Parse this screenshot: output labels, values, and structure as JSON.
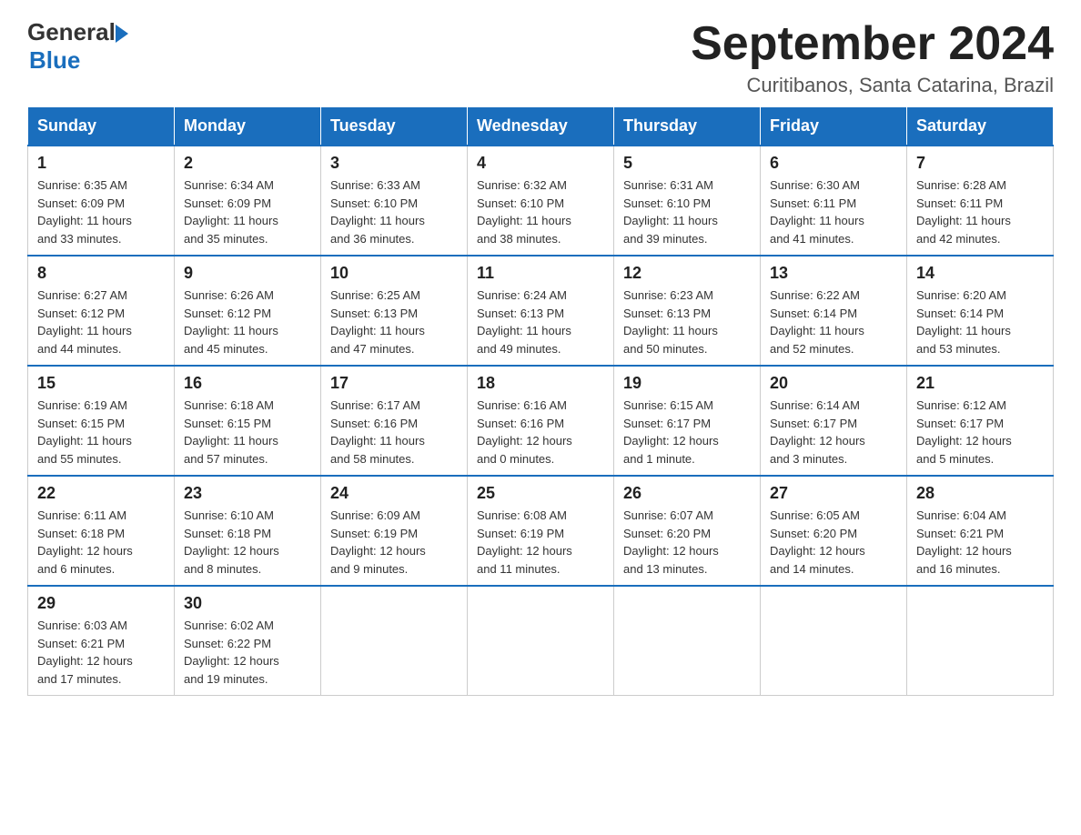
{
  "logo": {
    "text_general": "General",
    "text_blue": "Blue"
  },
  "title": "September 2024",
  "subtitle": "Curitibanos, Santa Catarina, Brazil",
  "days_of_week": [
    "Sunday",
    "Monday",
    "Tuesday",
    "Wednesday",
    "Thursday",
    "Friday",
    "Saturday"
  ],
  "weeks": [
    [
      {
        "day": "1",
        "sunrise": "6:35 AM",
        "sunset": "6:09 PM",
        "daylight": "11 hours and 33 minutes."
      },
      {
        "day": "2",
        "sunrise": "6:34 AM",
        "sunset": "6:09 PM",
        "daylight": "11 hours and 35 minutes."
      },
      {
        "day": "3",
        "sunrise": "6:33 AM",
        "sunset": "6:10 PM",
        "daylight": "11 hours and 36 minutes."
      },
      {
        "day": "4",
        "sunrise": "6:32 AM",
        "sunset": "6:10 PM",
        "daylight": "11 hours and 38 minutes."
      },
      {
        "day": "5",
        "sunrise": "6:31 AM",
        "sunset": "6:10 PM",
        "daylight": "11 hours and 39 minutes."
      },
      {
        "day": "6",
        "sunrise": "6:30 AM",
        "sunset": "6:11 PM",
        "daylight": "11 hours and 41 minutes."
      },
      {
        "day": "7",
        "sunrise": "6:28 AM",
        "sunset": "6:11 PM",
        "daylight": "11 hours and 42 minutes."
      }
    ],
    [
      {
        "day": "8",
        "sunrise": "6:27 AM",
        "sunset": "6:12 PM",
        "daylight": "11 hours and 44 minutes."
      },
      {
        "day": "9",
        "sunrise": "6:26 AM",
        "sunset": "6:12 PM",
        "daylight": "11 hours and 45 minutes."
      },
      {
        "day": "10",
        "sunrise": "6:25 AM",
        "sunset": "6:13 PM",
        "daylight": "11 hours and 47 minutes."
      },
      {
        "day": "11",
        "sunrise": "6:24 AM",
        "sunset": "6:13 PM",
        "daylight": "11 hours and 49 minutes."
      },
      {
        "day": "12",
        "sunrise": "6:23 AM",
        "sunset": "6:13 PM",
        "daylight": "11 hours and 50 minutes."
      },
      {
        "day": "13",
        "sunrise": "6:22 AM",
        "sunset": "6:14 PM",
        "daylight": "11 hours and 52 minutes."
      },
      {
        "day": "14",
        "sunrise": "6:20 AM",
        "sunset": "6:14 PM",
        "daylight": "11 hours and 53 minutes."
      }
    ],
    [
      {
        "day": "15",
        "sunrise": "6:19 AM",
        "sunset": "6:15 PM",
        "daylight": "11 hours and 55 minutes."
      },
      {
        "day": "16",
        "sunrise": "6:18 AM",
        "sunset": "6:15 PM",
        "daylight": "11 hours and 57 minutes."
      },
      {
        "day": "17",
        "sunrise": "6:17 AM",
        "sunset": "6:16 PM",
        "daylight": "11 hours and 58 minutes."
      },
      {
        "day": "18",
        "sunrise": "6:16 AM",
        "sunset": "6:16 PM",
        "daylight": "12 hours and 0 minutes."
      },
      {
        "day": "19",
        "sunrise": "6:15 AM",
        "sunset": "6:17 PM",
        "daylight": "12 hours and 1 minute."
      },
      {
        "day": "20",
        "sunrise": "6:14 AM",
        "sunset": "6:17 PM",
        "daylight": "12 hours and 3 minutes."
      },
      {
        "day": "21",
        "sunrise": "6:12 AM",
        "sunset": "6:17 PM",
        "daylight": "12 hours and 5 minutes."
      }
    ],
    [
      {
        "day": "22",
        "sunrise": "6:11 AM",
        "sunset": "6:18 PM",
        "daylight": "12 hours and 6 minutes."
      },
      {
        "day": "23",
        "sunrise": "6:10 AM",
        "sunset": "6:18 PM",
        "daylight": "12 hours and 8 minutes."
      },
      {
        "day": "24",
        "sunrise": "6:09 AM",
        "sunset": "6:19 PM",
        "daylight": "12 hours and 9 minutes."
      },
      {
        "day": "25",
        "sunrise": "6:08 AM",
        "sunset": "6:19 PM",
        "daylight": "12 hours and 11 minutes."
      },
      {
        "day": "26",
        "sunrise": "6:07 AM",
        "sunset": "6:20 PM",
        "daylight": "12 hours and 13 minutes."
      },
      {
        "day": "27",
        "sunrise": "6:05 AM",
        "sunset": "6:20 PM",
        "daylight": "12 hours and 14 minutes."
      },
      {
        "day": "28",
        "sunrise": "6:04 AM",
        "sunset": "6:21 PM",
        "daylight": "12 hours and 16 minutes."
      }
    ],
    [
      {
        "day": "29",
        "sunrise": "6:03 AM",
        "sunset": "6:21 PM",
        "daylight": "12 hours and 17 minutes."
      },
      {
        "day": "30",
        "sunrise": "6:02 AM",
        "sunset": "6:22 PM",
        "daylight": "12 hours and 19 minutes."
      },
      null,
      null,
      null,
      null,
      null
    ]
  ],
  "labels": {
    "sunrise": "Sunrise:",
    "sunset": "Sunset:",
    "daylight": "Daylight:"
  }
}
